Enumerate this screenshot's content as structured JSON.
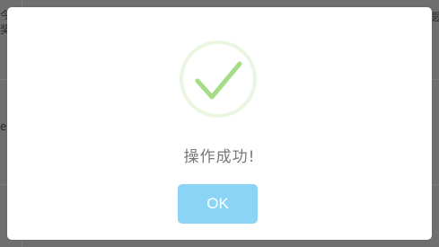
{
  "background": {
    "fragments": [
      "今",
      "奖",
      "e",
      "题"
    ]
  },
  "dialog": {
    "icon": "success-checkmark-icon",
    "message": "操作成功!",
    "ok_label": "OK",
    "colors": {
      "ring": "#eaf6e2",
      "check": "#a5dc86",
      "button": "#8cd4f5",
      "message": "#797979"
    }
  }
}
